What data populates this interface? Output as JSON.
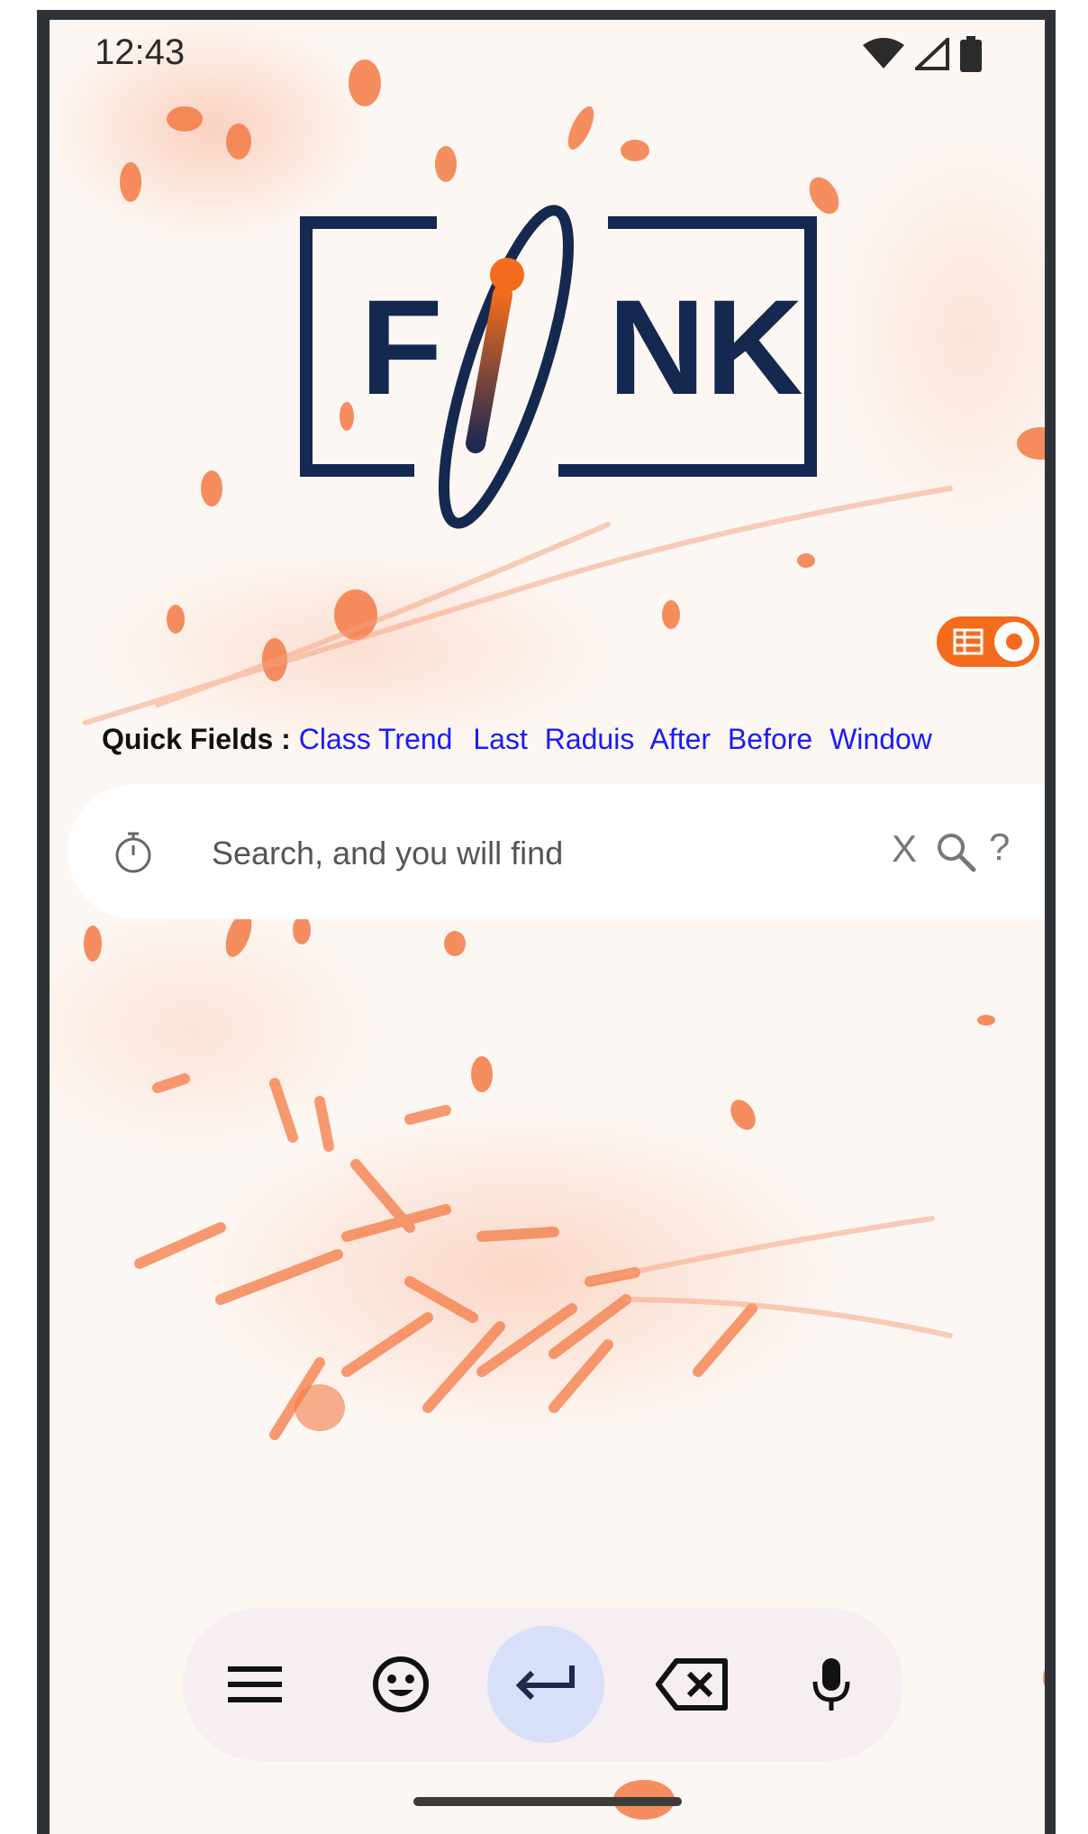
{
  "status_bar": {
    "time": "12:43"
  },
  "brand": {
    "logo_text": "FINK",
    "colors": {
      "navy": "#142850",
      "orange": "#f36b1c"
    }
  },
  "quick_fields": {
    "label": "Quick Fields :",
    "items": [
      "Class Trend",
      "Last",
      "Raduis",
      "After",
      "Before",
      "Window"
    ]
  },
  "search": {
    "placeholder": "Search, and you will find",
    "clear_label": "X",
    "help_label": "?"
  },
  "keyboard": {
    "keys": [
      "menu-icon",
      "emoji-icon",
      "enter-icon",
      "backspace-icon",
      "microphone-icon"
    ]
  }
}
